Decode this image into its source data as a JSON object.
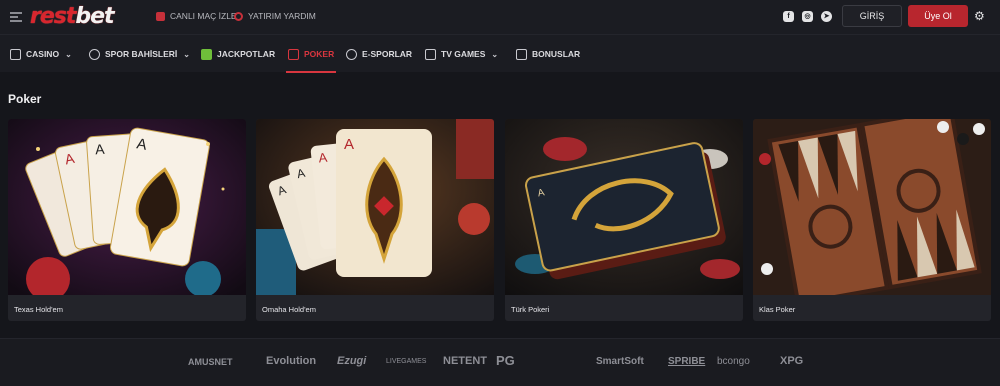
{
  "brand": {
    "logo_main": "rest",
    "logo_accent": "bet"
  },
  "topbar": {
    "links": [
      {
        "label": "CANLI MAÇ İZLE",
        "icon": "tv-icon"
      },
      {
        "label": "YATIRIM YARDIM",
        "icon": "help-icon"
      }
    ],
    "social": [
      {
        "icon": "facebook-icon",
        "glyph": "f"
      },
      {
        "icon": "instagram-icon",
        "glyph": "◎"
      },
      {
        "icon": "telegram-icon",
        "glyph": "➤"
      }
    ],
    "login_label": "GİRİŞ",
    "register_label": "Üye Ol"
  },
  "nav": {
    "items": [
      {
        "label": "CASINO",
        "icon": "casino-icon",
        "dropdown": true
      },
      {
        "label": "SPOR BAHİSLERİ",
        "icon": "ball-icon",
        "dropdown": true
      },
      {
        "label": "JACKPOTLAR",
        "icon": "jackpot-icon",
        "dropdown": false
      },
      {
        "label": "POKER",
        "icon": "poker-icon",
        "dropdown": false,
        "active": true
      },
      {
        "label": "E-SPORLAR",
        "icon": "esports-icon",
        "dropdown": false
      },
      {
        "label": "TV GAMES",
        "icon": "tv-games-icon",
        "dropdown": true
      },
      {
        "label": "BONUSLAR",
        "icon": "megaphone-icon",
        "dropdown": false
      }
    ]
  },
  "section": {
    "title": "Poker"
  },
  "games": [
    {
      "title": "Texas Hold'em"
    },
    {
      "title": "Omaha Hold'em"
    },
    {
      "title": "Türk Pokeri"
    },
    {
      "title": "Klas Poker"
    }
  ],
  "providers": [
    "AMUSNET",
    "Evolution",
    "Ezugi",
    "LIVEGAMES",
    "NETENT",
    "PG",
    "SmartSoft",
    "SPRIBE",
    "bcongo",
    "XPG"
  ],
  "colors": {
    "accent": "#d8262e",
    "background": "#15161b",
    "bar": "#1b1c22",
    "active_nav": "#d8363f"
  }
}
